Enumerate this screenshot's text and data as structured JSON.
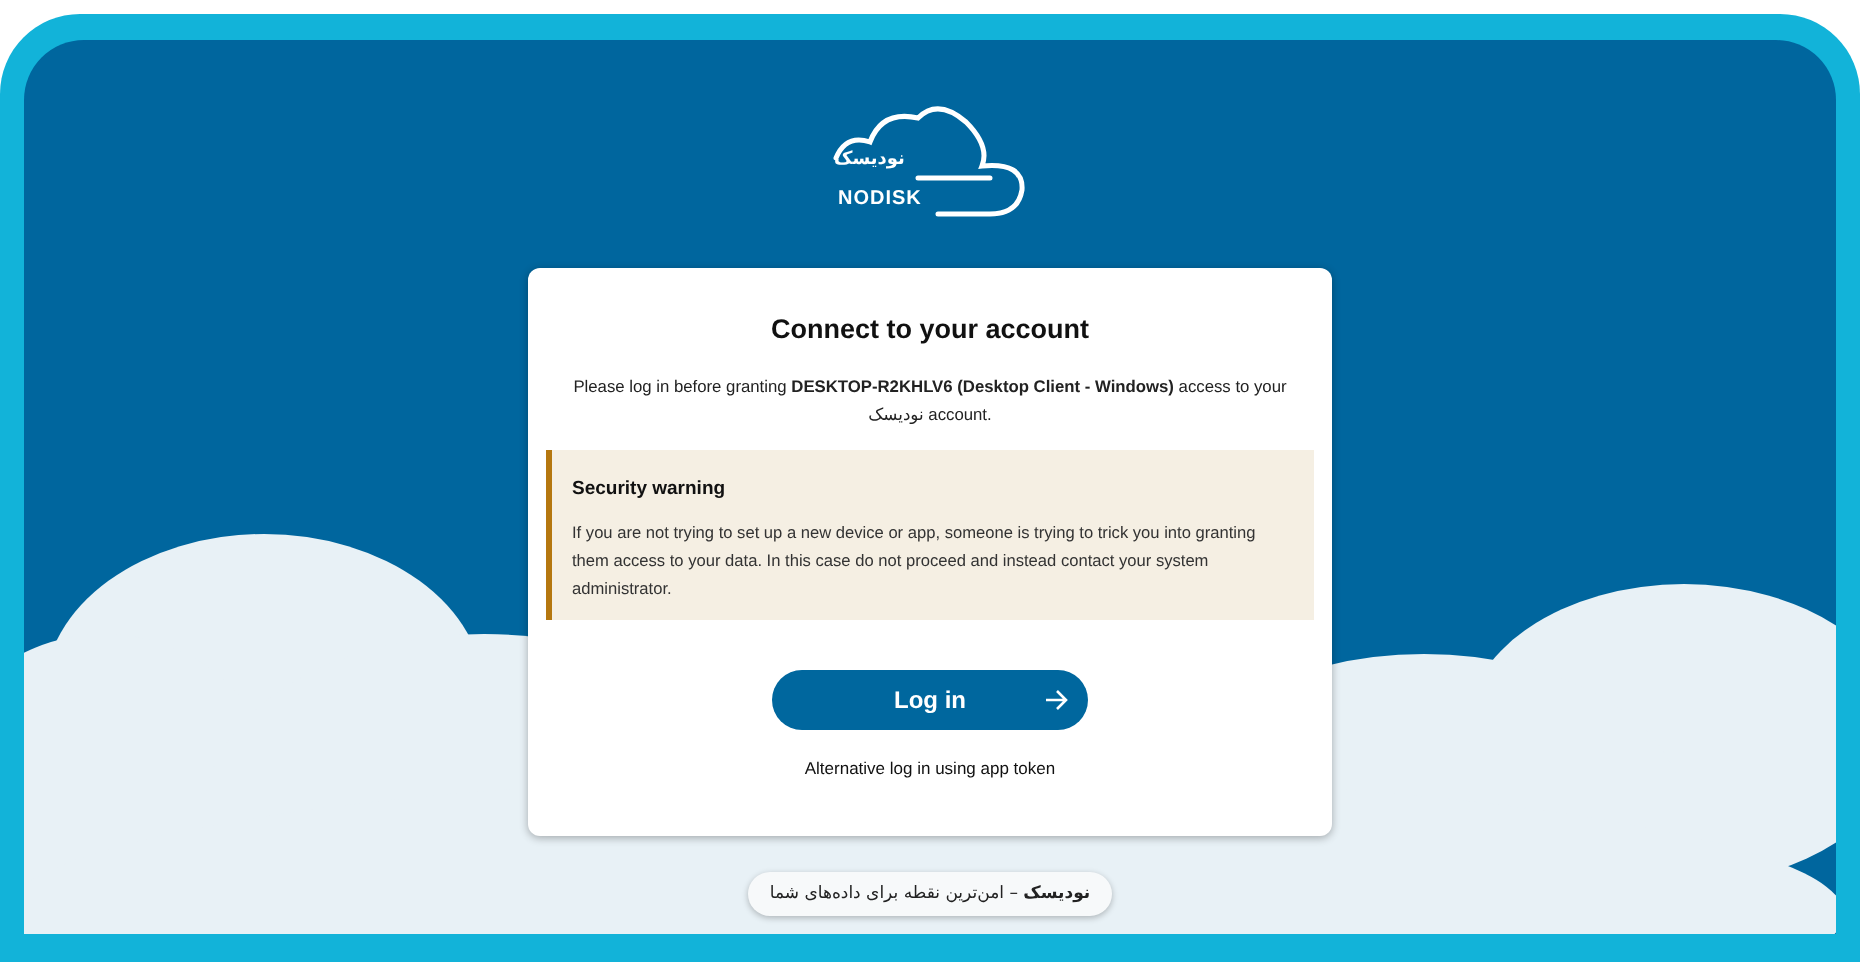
{
  "logo": {
    "name_fa": "نودیسک",
    "name_en": "NODISK"
  },
  "card": {
    "title": "Connect to your account",
    "intro": "Please log in before granting **DESKTOP-R2KHLV6 (Desktop Client - Windows)** access to your نودیسک account.",
    "warning": {
      "title": "Security warning",
      "text": "If you are not trying to set up a new device or app, someone is trying to trick you into granting them access to your data. In this case do not proceed and instead contact your system administrator."
    },
    "login_button": "Log in",
    "alt_link": "Alternative log in using app token"
  },
  "footer": "**نودیسک** – امن‌ترین نقطه برای داده‌های شما"
}
